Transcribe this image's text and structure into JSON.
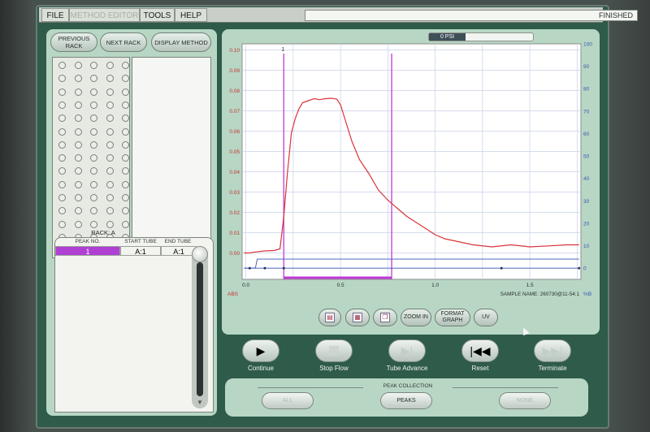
{
  "menu": {
    "file": "FILE",
    "method_editor": "METHOD EDITOR",
    "tools": "TOOLS",
    "help": "HELP",
    "status": "FINISHED"
  },
  "rack_buttons": {
    "previous": "PREVIOUS RACK",
    "next": "NEXT RACK",
    "display_method": "DISPLAY METHOD"
  },
  "rack": {
    "label": "RACK: A",
    "active_well_label": "1",
    "columns": 5,
    "rows": 15
  },
  "peak_table": {
    "headers": [
      "PEAK NO.",
      "START TUBE",
      "END TUBE"
    ],
    "rows": [
      [
        "1",
        "A:1",
        "A:1"
      ]
    ]
  },
  "graph": {
    "psi_label": "0 PSI",
    "left_unit": "ABS",
    "right_unit": "%B",
    "sample_name": "SAMPLE NAME: 260730@11-54:1",
    "peak_marker_label": "1",
    "colors": {
      "abs": "#d8343a",
      "percent_b": "#3b56b5",
      "marker": "#c03ad8"
    }
  },
  "chart_data": {
    "type": "line",
    "xlabel": "",
    "ylabel": "ABS",
    "y2label": "%B",
    "xlim": [
      -0.02,
      1.77
    ],
    "ylim": [
      -0.013,
      0.103
    ],
    "y2lim": [
      -5,
      100
    ],
    "x_ticks": [
      0.0,
      0.5,
      1.0,
      1.5
    ],
    "x_tick_labels": [
      "0.0",
      "0.5",
      "1.0",
      "1.5"
    ],
    "y_ticks": [
      0.0,
      0.01,
      0.02,
      0.03,
      0.04,
      0.05,
      0.06,
      0.07,
      0.08,
      0.09,
      0.1
    ],
    "y_tick_labels": [
      "0.00",
      "0.01",
      "0.02",
      "0.03",
      "0.04",
      "0.05",
      "0.06",
      "0.07",
      "0.08",
      "0.09",
      "0.10"
    ],
    "y2_ticks": [
      0,
      10,
      20,
      30,
      40,
      50,
      60,
      70,
      80,
      90,
      100
    ],
    "y2_tick_labels": [
      "0",
      "10",
      "20",
      "30",
      "40",
      "50",
      "60",
      "70",
      "80",
      "90",
      "100"
    ],
    "grid": true,
    "series": [
      {
        "axis": "left",
        "x": [
          -0.01,
          0.02,
          0.05,
          0.1,
          0.15,
          0.18,
          0.2,
          0.22,
          0.24,
          0.26,
          0.28,
          0.3,
          0.33,
          0.36,
          0.39,
          0.42,
          0.45,
          0.48,
          0.5,
          0.53,
          0.56,
          0.6,
          0.65,
          0.7,
          0.75,
          0.8,
          0.85,
          0.9,
          0.95,
          1.0,
          1.05,
          1.1,
          1.2,
          1.3,
          1.4,
          1.5,
          1.6,
          1.7,
          1.76
        ],
        "y": [
          0.0,
          0.0,
          0.0005,
          0.001,
          0.0012,
          0.002,
          0.018,
          0.04,
          0.059,
          0.066,
          0.071,
          0.074,
          0.075,
          0.076,
          0.0755,
          0.076,
          0.0762,
          0.0758,
          0.073,
          0.064,
          0.055,
          0.046,
          0.039,
          0.031,
          0.026,
          0.022,
          0.018,
          0.015,
          0.012,
          0.009,
          0.007,
          0.006,
          0.004,
          0.003,
          0.004,
          0.003,
          0.0035,
          0.004,
          0.004
        ]
      },
      {
        "axis": "right",
        "x": [
          -0.01,
          0.05,
          0.06,
          0.2,
          0.5,
          1.0,
          1.3,
          1.5,
          1.76
        ],
        "y": [
          0,
          0,
          4,
          4,
          4,
          4,
          4,
          4,
          4
        ]
      },
      {
        "axis": "right",
        "x": [
          -0.01,
          0.2,
          0.5,
          1.0,
          1.3,
          1.5,
          1.76
        ],
        "y": [
          0,
          0,
          0,
          0,
          0,
          0,
          0
        ]
      }
    ],
    "markers": {
      "peak_start_x": 0.2,
      "peak_end_x": 0.77,
      "points_x": [
        0.02,
        0.1,
        0.2,
        1.35,
        1.76
      ]
    }
  },
  "graph_tools": {
    "zoom_in": "ZOOM IN",
    "format_graph": "FORMAT GRAPH",
    "uv": "UV"
  },
  "controls": {
    "continue": "Continue",
    "stop_flow": "Stop Flow",
    "tube_advance": "Tube Advance",
    "reset": "Reset",
    "terminate": "Terminate"
  },
  "peak_collection": {
    "title": "PEAK COLLECTION",
    "all": "ALL",
    "peaks": "PEAKS",
    "none": "NONE"
  }
}
